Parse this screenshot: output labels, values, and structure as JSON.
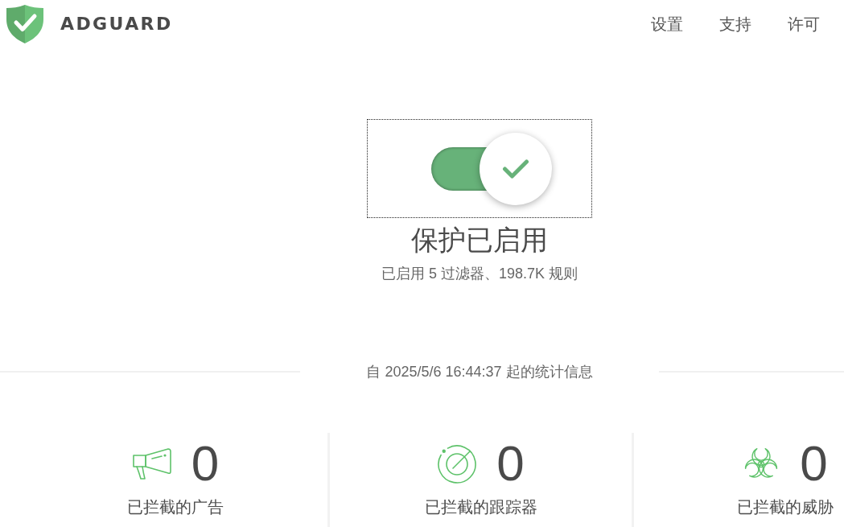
{
  "header": {
    "brand": "ADGUARD",
    "nav": [
      {
        "label": "设置"
      },
      {
        "label": "支持"
      },
      {
        "label": "许可"
      }
    ]
  },
  "protection": {
    "toggle": {
      "on": true,
      "focused": true
    },
    "title": "保护已启用",
    "subtitle": "已启用 5 过滤器、198.7K 规则"
  },
  "stats": {
    "since": "自 2025/5/6 16:44:37 起的统计信息",
    "items": [
      {
        "kind": "ads",
        "count": "0",
        "label": "已拦截的广告"
      },
      {
        "kind": "trackers",
        "count": "0",
        "label": "已拦截的跟踪器"
      },
      {
        "kind": "threats",
        "count": "0",
        "label": "已拦截的威胁"
      }
    ]
  }
}
